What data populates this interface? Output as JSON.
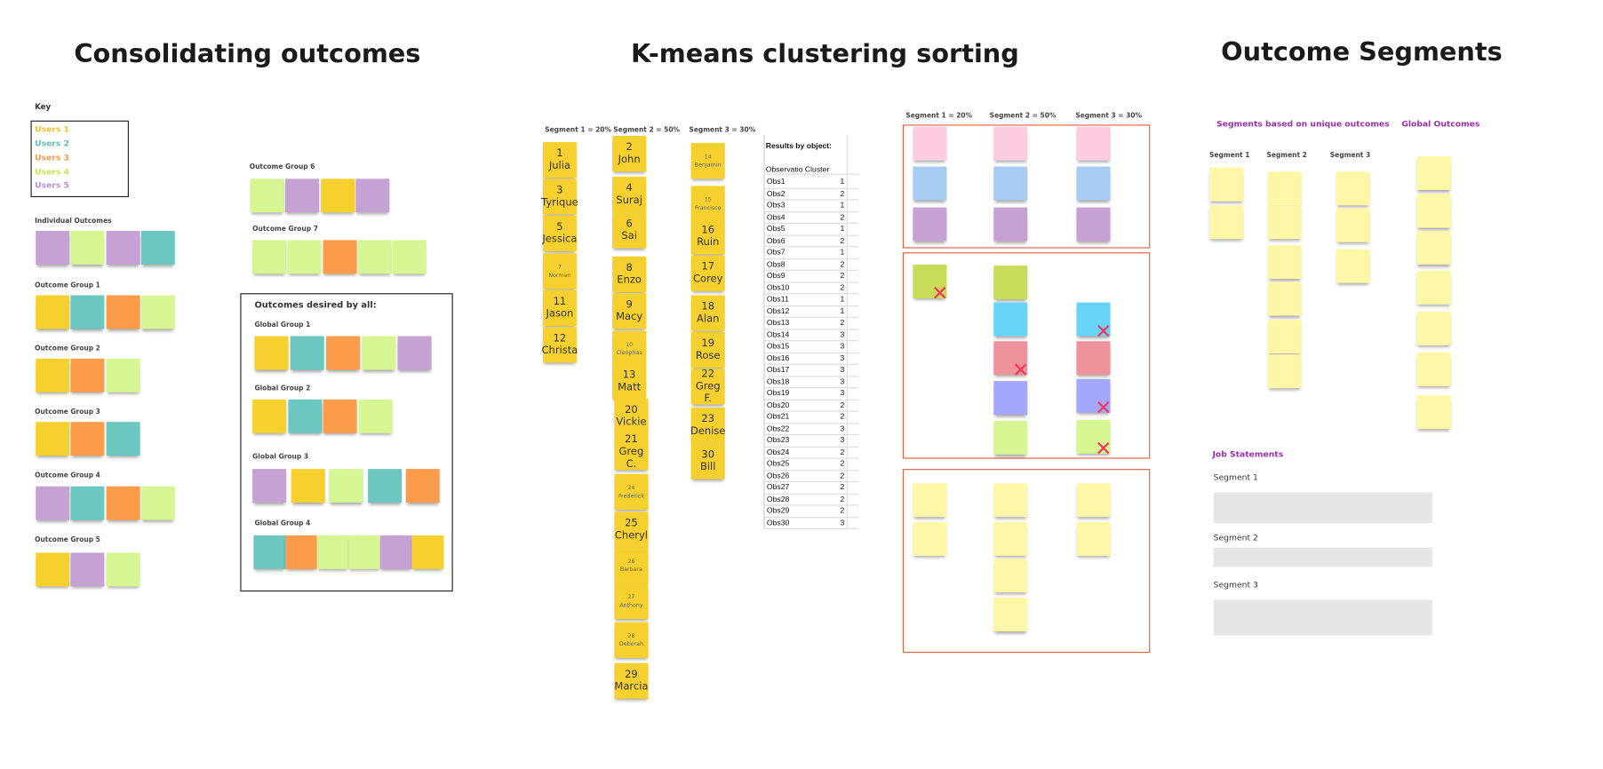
{
  "colors": {
    "yellow": "#f5d02e",
    "teal": "#6cc7c0",
    "orange": "#fd9c4b",
    "lime": "#d6f593",
    "purple": "#c6a2d4",
    "pink": "#fccde0",
    "blue": "#a8cbf2",
    "green": "#c8dc5a",
    "cyan": "#67d6f6",
    "salmon": "#ef929c",
    "periwinkle": "#a4a8fa",
    "lightyellow": "#fff7a8",
    "frame_red": "#e0623f",
    "x_mark": "#ee3a5e",
    "heading_purple": "#9b2fae"
  },
  "consolidating": {
    "title": "Consolidating outcomes",
    "key": {
      "label": "Key",
      "items": [
        {
          "label": "Users 1",
          "color": "#f2c12e"
        },
        {
          "label": "Users 2",
          "color": "#5bbfb5"
        },
        {
          "label": "Users 3",
          "color": "#f79a4a"
        },
        {
          "label": "Users 4",
          "color": "#c6e84a"
        },
        {
          "label": "Users 5",
          "color": "#b98fd0"
        }
      ]
    },
    "groups": [
      {
        "label": "Individual Outcomes",
        "notes": [
          "purple",
          "lime",
          "purple",
          "teal"
        ]
      },
      {
        "label": "Outcome Group 1",
        "notes": [
          "yellow",
          "teal",
          "orange",
          "lime"
        ]
      },
      {
        "label": "Outcome Group 2",
        "notes": [
          "yellow",
          "orange",
          "lime"
        ]
      },
      {
        "label": "Outcome Group 3",
        "notes": [
          "yellow",
          "orange",
          "teal"
        ]
      },
      {
        "label": "Outcome Group 4",
        "notes": [
          "purple",
          "teal",
          "orange",
          "lime"
        ]
      },
      {
        "label": "Outcome Group 5",
        "notes": [
          "yellow",
          "purple",
          "lime"
        ]
      },
      {
        "label": "Outcome Group 6",
        "notes": [
          "lime",
          "purple",
          "yellow",
          "purple"
        ]
      },
      {
        "label": "Outcome Group 7",
        "notes": [
          "lime",
          "lime",
          "orange",
          "lime",
          "lime"
        ]
      }
    ],
    "desired_by_all": {
      "title": "Outcomes desired by all:",
      "groups": [
        {
          "label": "Global Group 1",
          "notes": [
            "yellow",
            "teal",
            "orange",
            "lime",
            "purple"
          ]
        },
        {
          "label": "Global Group 2",
          "notes": [
            "yellow",
            "teal",
            "orange",
            "lime"
          ]
        },
        {
          "label": "Global Group 3",
          "notes": [
            "purple",
            "yellow",
            "lime",
            "teal",
            "orange"
          ]
        },
        {
          "label": "Global Group 4",
          "notes": [
            "teal",
            "orange",
            "lime",
            "lime",
            "purple",
            "yellow"
          ]
        }
      ]
    }
  },
  "kmeans": {
    "title": "K-means clustering sorting",
    "segments": [
      {
        "label": "Segment 1 = 20%",
        "people": [
          {
            "num": "1",
            "name": "Julia"
          },
          {
            "num": "3",
            "name": "Tyrique"
          },
          {
            "num": "5",
            "name": "Jessica"
          },
          {
            "num": "7",
            "name": "Norman",
            "small": true
          },
          {
            "num": "11",
            "name": "Jason"
          },
          {
            "num": "12",
            "name": "Christa"
          }
        ]
      },
      {
        "label": "Segment 2 = 50%",
        "people": [
          {
            "num": "2",
            "name": "John"
          },
          {
            "num": "4",
            "name": "Suraj"
          },
          {
            "num": "6",
            "name": "Sai"
          },
          {
            "num": "8",
            "name": "Enzo"
          },
          {
            "num": "9",
            "name": "Macy"
          },
          {
            "num": "10",
            "name": "Cleophas",
            "small": true
          },
          {
            "num": "13",
            "name": "Matt"
          },
          {
            "num": "20",
            "name": "Vickie"
          },
          {
            "num": "21",
            "name": "Greg C."
          },
          {
            "num": "24",
            "name": "Frederick",
            "small": true
          },
          {
            "num": "25",
            "name": "Cheryl"
          },
          {
            "num": "26",
            "name": "Barbara",
            "small": true
          },
          {
            "num": "27",
            "name": "Anthony",
            "small": true
          },
          {
            "num": "28",
            "name": "Deborah",
            "small": true
          },
          {
            "num": "29",
            "name": "Marcia"
          }
        ]
      },
      {
        "label": "Segment 3 = 30%",
        "people": [
          {
            "num": "14",
            "name": "Benjamin",
            "small": true
          },
          {
            "num": "15",
            "name": "Francisco",
            "small": true
          },
          {
            "num": "16",
            "name": "Ruin"
          },
          {
            "num": "17",
            "name": "Corey"
          },
          {
            "num": "18",
            "name": "Alan"
          },
          {
            "num": "19",
            "name": "Rose"
          },
          {
            "num": "22",
            "name": "Greg F."
          },
          {
            "num": "23",
            "name": "Denise"
          },
          {
            "num": "30",
            "name": "Bill"
          }
        ]
      }
    ],
    "results_table": {
      "title": "Results by object:",
      "headers": [
        "Observatio",
        "Cluster"
      ],
      "rows": [
        [
          "Obs1",
          1
        ],
        [
          "Obs2",
          2
        ],
        [
          "Obs3",
          1
        ],
        [
          "Obs4",
          2
        ],
        [
          "Obs5",
          1
        ],
        [
          "Obs6",
          2
        ],
        [
          "Obs7",
          1
        ],
        [
          "Obs8",
          2
        ],
        [
          "Obs9",
          2
        ],
        [
          "Obs10",
          2
        ],
        [
          "Obs11",
          1
        ],
        [
          "Obs12",
          1
        ],
        [
          "Obs13",
          2
        ],
        [
          "Obs14",
          3
        ],
        [
          "Obs15",
          3
        ],
        [
          "Obs16",
          3
        ],
        [
          "Obs17",
          3
        ],
        [
          "Obs18",
          3
        ],
        [
          "Obs19",
          3
        ],
        [
          "Obs20",
          2
        ],
        [
          "Obs21",
          2
        ],
        [
          "Obs22",
          3
        ],
        [
          "Obs23",
          3
        ],
        [
          "Obs24",
          2
        ],
        [
          "Obs25",
          2
        ],
        [
          "Obs26",
          2
        ],
        [
          "Obs27",
          2
        ],
        [
          "Obs28",
          2
        ],
        [
          "Obs29",
          2
        ],
        [
          "Obs30",
          3
        ]
      ]
    },
    "matrix": {
      "headers": [
        "Segment 1 = 20%",
        "Segment 2 = 50%",
        "Segment 3 = 30%"
      ],
      "boxes": [
        {
          "columns": [
            [
              {
                "color": "pink"
              },
              {
                "color": "blue"
              },
              {
                "color": "purple"
              }
            ],
            [
              {
                "color": "pink"
              },
              {
                "color": "blue"
              },
              {
                "color": "purple"
              }
            ],
            [
              {
                "color": "pink"
              },
              {
                "color": "blue"
              },
              {
                "color": "purple"
              }
            ]
          ]
        },
        {
          "columns": [
            [
              {
                "color": "green",
                "crossed": true
              }
            ],
            [
              {
                "color": "green"
              },
              {
                "color": "cyan"
              },
              {
                "color": "salmon",
                "crossed": true
              },
              {
                "color": "periwinkle"
              },
              {
                "color": "lime"
              }
            ],
            [
              {
                "color": "cyan",
                "crossed": true
              },
              {
                "color": "salmon"
              },
              {
                "color": "periwinkle",
                "crossed": true
              },
              {
                "color": "lime",
                "crossed": true
              }
            ]
          ]
        },
        {
          "columns": [
            [
              {
                "color": "lightyellow"
              },
              {
                "color": "lightyellow"
              }
            ],
            [
              {
                "color": "lightyellow"
              },
              {
                "color": "lightyellow"
              },
              {
                "color": "lightyellow"
              },
              {
                "color": "lightyellow"
              }
            ],
            [
              {
                "color": "lightyellow"
              },
              {
                "color": "lightyellow"
              }
            ]
          ]
        }
      ]
    }
  },
  "segments_section": {
    "title": "Outcome Segments",
    "unique_heading": "Segments based on unique outcomes",
    "global_heading": "Global Outcomes",
    "segment_columns": [
      {
        "label": "Segment 1",
        "count": 2
      },
      {
        "label": "Segment 2",
        "count": 6
      },
      {
        "label": "Segment 3",
        "count": 3
      }
    ],
    "global_count": 7,
    "job_statements": {
      "heading": "Job Statements",
      "segments": [
        "Segment 1",
        "Segment 2",
        "Segment 3"
      ]
    }
  }
}
